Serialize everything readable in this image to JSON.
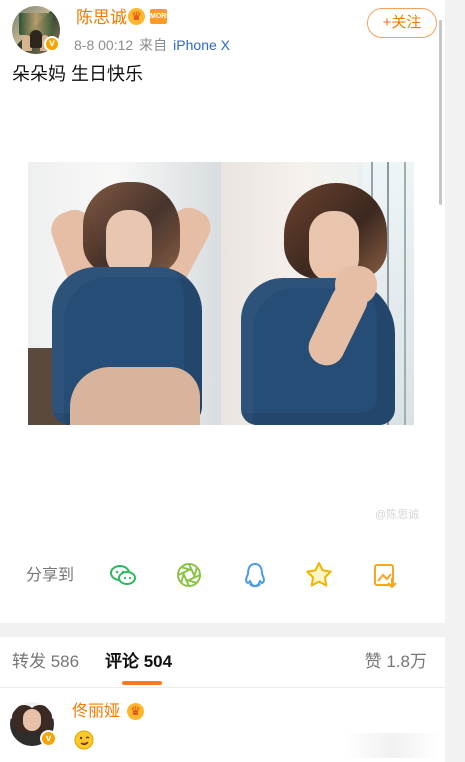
{
  "post": {
    "author": "陈思诚",
    "verified_mark": "v",
    "crown_mark": "♛",
    "member_badge": "MORE",
    "time": "8-8 00:12",
    "source_prefix": "来自",
    "device": "iPhone X",
    "follow_label": "+关注",
    "text": "朵朵妈 生日快乐",
    "watermark": "@陈思诚"
  },
  "share": {
    "label": "分享到",
    "icons": [
      "wechat-icon",
      "moments-icon",
      "qq-icon",
      "favorite-icon",
      "save-image-icon"
    ]
  },
  "tabs": {
    "repost": "转发 586",
    "comments": "评论 504",
    "likes": "赞 1.8万"
  },
  "comment": {
    "author": "佟丽娅",
    "verified_mark": "v",
    "crown_mark": "♛",
    "emoji": "emoji-icon"
  },
  "colors": {
    "accent": "#f07b00",
    "link": "#2f67c8",
    "tab_indicator": "#ff7a1a",
    "wechat": "#2eb85c",
    "moments": "#8bc34a",
    "qq": "#4a9be8",
    "favorite": "#f1b400",
    "save_image": "#f5a623"
  }
}
